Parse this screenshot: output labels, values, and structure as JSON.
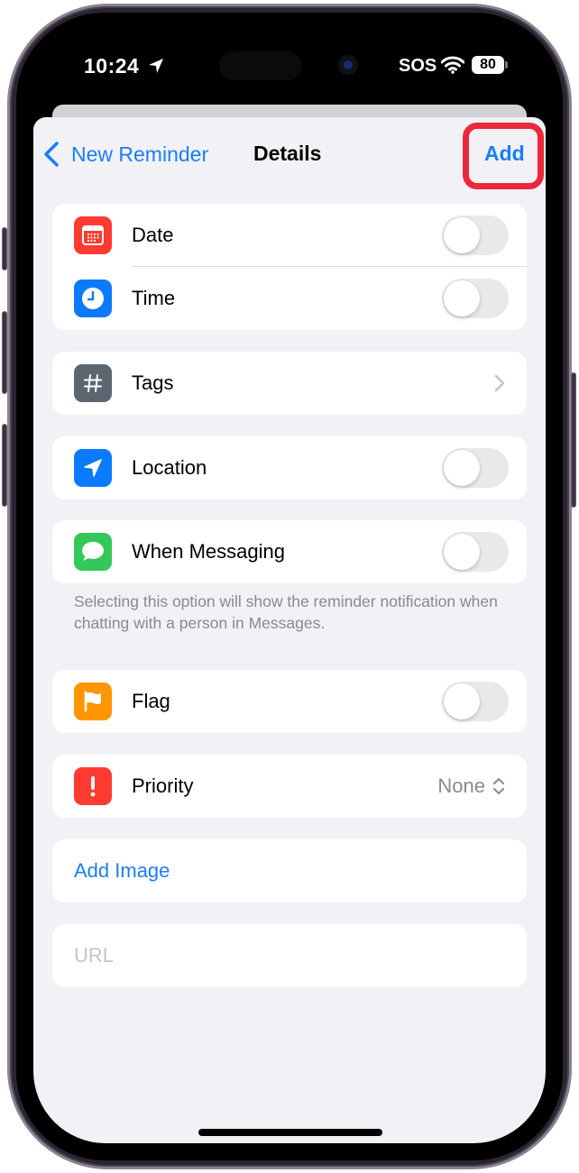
{
  "status_bar": {
    "time": "10:24",
    "location_icon": "location-arrow-icon",
    "carrier": "SOS",
    "wifi_icon": "wifi-icon",
    "battery_level": "80"
  },
  "nav": {
    "back_label": "New Reminder",
    "title": "Details",
    "add_label": "Add",
    "highlight_color": "#ea2a3c"
  },
  "groups": {
    "date_time": [
      {
        "label": "Date",
        "icon": "calendar-icon",
        "icon_color": "#fe3b30",
        "toggle_on": false
      },
      {
        "label": "Time",
        "icon": "clock-icon",
        "icon_color": "#0a7aff",
        "toggle_on": false
      }
    ],
    "tags": {
      "label": "Tags",
      "icon": "hashtag-icon",
      "icon_color": "#5b6670"
    },
    "location": {
      "label": "Location",
      "icon": "location-arrow-icon",
      "icon_color": "#0a7aff",
      "toggle_on": false
    },
    "messaging": {
      "label": "When Messaging",
      "icon": "message-bubble-icon",
      "icon_color": "#34c759",
      "toggle_on": false,
      "footnote": "Selecting this option will show the reminder notification when chatting with a person in Messages."
    },
    "flag": {
      "label": "Flag",
      "icon": "flag-icon",
      "icon_color": "#ff9500",
      "toggle_on": false
    },
    "priority": {
      "label": "Priority",
      "icon": "exclamation-icon",
      "icon_color": "#fe3b30",
      "value": "None"
    },
    "add_image": {
      "label": "Add Image"
    },
    "url": {
      "placeholder": "URL",
      "value": ""
    }
  },
  "colors": {
    "accent": "#1a7ef5",
    "background": "#f2f1f6",
    "secondary_text": "#8a8a8e"
  }
}
